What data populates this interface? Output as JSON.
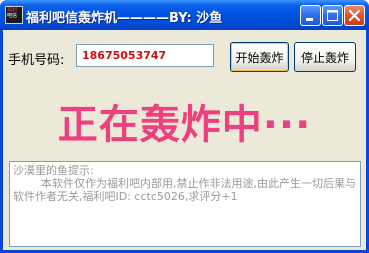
{
  "window": {
    "title": "福利吧信轰炸机————BY: 沙鱼",
    "icon_lines": [
      "福利",
      "吧信"
    ],
    "controls": {
      "minimize": "minimize-icon",
      "maximize": "maximize-icon",
      "close": "close-icon"
    }
  },
  "form": {
    "phone_label": "手机号码:",
    "phone_value": "18675053747",
    "start_button": "开始轰炸",
    "stop_button": "停止轰炸"
  },
  "status": {
    "banner": "正在轰炸中···"
  },
  "notice": {
    "text": "沙漠里的鱼提示:\n        本软件仅作为福利吧内部用,禁止作非法用途,由此产生一切后果与软件作者无关,福利吧ID: cctc5026,求评分+1"
  },
  "colors": {
    "title_bar": "#0052e0",
    "banner": "#ee3f7e",
    "phone_text": "#d01010",
    "window_bg": "#ece9d8"
  }
}
